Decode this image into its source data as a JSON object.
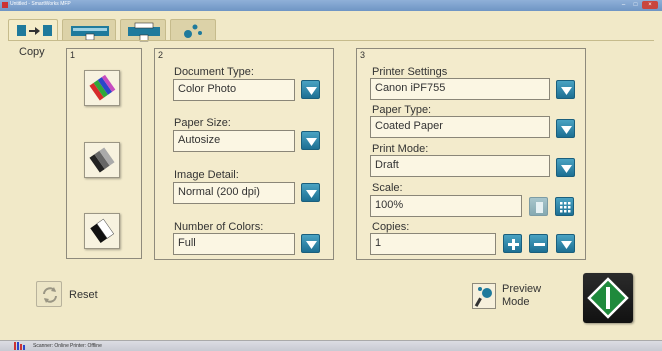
{
  "window": {
    "title": "Untitled - SmartWorks MFP"
  },
  "tabs": [
    {
      "name": "copy",
      "active": true
    },
    {
      "name": "scan",
      "active": false
    },
    {
      "name": "print",
      "active": false
    },
    {
      "name": "tools",
      "active": false
    }
  ],
  "copy_label": "Copy",
  "panel1": {
    "number": "1",
    "modes": [
      "color",
      "grayscale",
      "black-and-white"
    ],
    "selected": "color"
  },
  "panel2": {
    "number": "2",
    "document_type": {
      "label": "Document Type:",
      "value": "Color Photo"
    },
    "paper_size": {
      "label": "Paper Size:",
      "value": "Autosize"
    },
    "image_detail": {
      "label": "Image Detail:",
      "value": "Normal (200 dpi)"
    },
    "number_of_colors": {
      "label": "Number of Colors:",
      "value": "Full"
    }
  },
  "panel3": {
    "number": "3",
    "printer_settings": {
      "label": "Printer Settings",
      "value": "Canon iPF755"
    },
    "paper_type": {
      "label": "Paper Type:",
      "value": "Coated Paper"
    },
    "print_mode": {
      "label": "Print Mode:",
      "value": "Draft"
    },
    "scale": {
      "label": "Scale:",
      "value": "100%"
    },
    "copies": {
      "label": "Copies:",
      "value": "1"
    }
  },
  "bottom": {
    "reset_label": "Reset",
    "preview_label_line1": "Preview",
    "preview_label_line2": "Mode"
  },
  "status": {
    "scanner": "Scanner: Online",
    "printer": "Printer: Offline"
  },
  "colors": {
    "background": "#f1e9c8",
    "accent_blue": "#2a86ab",
    "start_green": "#1f8a3c"
  }
}
